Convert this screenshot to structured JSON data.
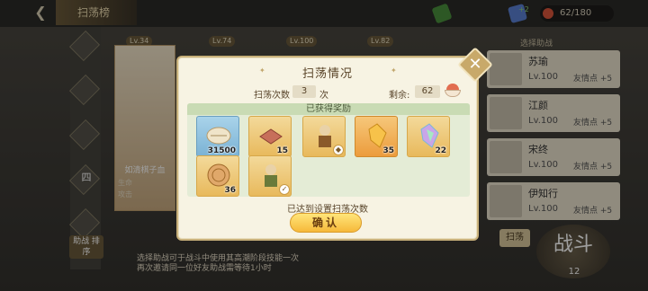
{
  "header": {
    "title": "扫荡情况",
    "back_icon": "back-arrow-icon",
    "stamina": "62/180",
    "bg_title": "扫荡榜",
    "res_badge": "+2"
  },
  "background": {
    "side_tab_label": "四",
    "cards": [
      "Lv.34",
      "Lv.74",
      "Lv.100",
      "Lv.82"
    ],
    "hero_name": "如清棋子血",
    "hero_stats": [
      "生命",
      "攻击"
    ],
    "friend_panel_title": "选择助战",
    "friends": [
      {
        "name": "苏瑜",
        "lv": "Lv.100",
        "fp": "友情点 +5"
      },
      {
        "name": "江颜",
        "lv": "Lv.100",
        "fp": "友情点 +5"
      },
      {
        "name": "宋终",
        "lv": "Lv.100",
        "fp": "友情点 +5"
      },
      {
        "name": "伊知行",
        "lv": "Lv.100",
        "fp": "友情点 +5"
      }
    ],
    "left_button": "助战\n排序",
    "bottom_note_1": "选择助战可于战斗中使用其高潮阶段技能一次",
    "bottom_note_2": "再次邀请同一位好友助战需等待1小时",
    "sweep_label": "扫荡",
    "battle_label": "战斗",
    "battle_cost": "12"
  },
  "modal": {
    "title": "扫荡情况",
    "count_label": "扫荡次数",
    "count_value": "3",
    "count_unit": "次",
    "remain_label": "剩余:",
    "remain_value": "62",
    "rewards_header": "已获得奖励",
    "rewards": [
      {
        "icon": "shell-coin-icon",
        "qty": "31500",
        "style": "blue"
      },
      {
        "icon": "brick-material-icon",
        "qty": "15",
        "style": "gold"
      },
      {
        "icon": "hero-fragment-icon",
        "qty": "",
        "style": "gold"
      },
      {
        "icon": "amber-stone-icon",
        "qty": "35",
        "style": "orange"
      },
      {
        "icon": "rainbow-stone-icon",
        "qty": "22",
        "style": "gold"
      },
      {
        "icon": "copper-coin-icon",
        "qty": "36",
        "style": "gold"
      },
      {
        "icon": "hero-fragment-icon",
        "qty": "",
        "style": "gold"
      }
    ],
    "done_text": "已达到设置扫荡次数",
    "confirm_label": "确认",
    "close_icon": "close-icon"
  }
}
